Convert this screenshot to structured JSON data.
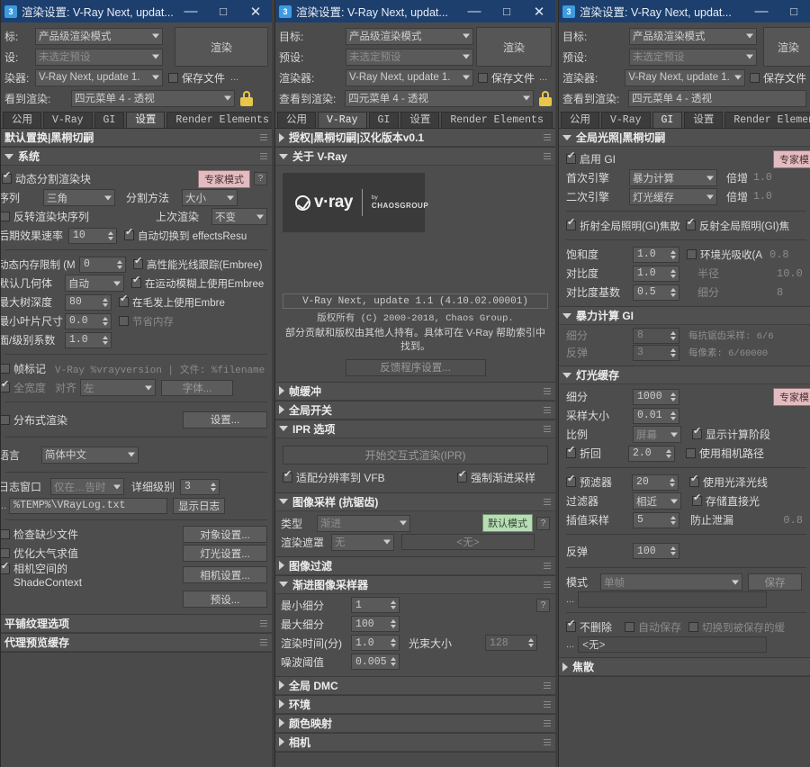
{
  "window": {
    "title": "渲染设置: V-Ray Next, updat...",
    "minimize": "—",
    "maximize": "□",
    "close": "✕",
    "icon_char": "3"
  },
  "topform": {
    "target_label": "目标:",
    "target_label_clipped": "标:",
    "target_value": "产品级渲染模式",
    "preset_label": "预设:",
    "preset_label_clipped": "设:",
    "preset_value": "未选定预设",
    "renderer_label": "渲染器:",
    "renderer_label_clipped": "染器:",
    "renderer_value": "V-Ray Next, update 1.",
    "view_label": "查看到渲染:",
    "view_label_clipped": "看到渲染:",
    "view_value": "四元菜单 4 - 透视",
    "render_button": "渲染",
    "save_file_label": "保存文件",
    "ellipsis": "..."
  },
  "tabs": {
    "items": [
      "公用",
      "V-Ray",
      "GI",
      "设置",
      "Render Elements"
    ],
    "active_win1": "设置",
    "active_win2": "V-Ray",
    "active_win3": "GI"
  },
  "win1": {
    "rollout_default": "默认置换|黑桐切嗣",
    "system": {
      "title": "系统",
      "expert_badge": "专家模式",
      "help": "?",
      "dynamic_split_label": "动态分割渲染块",
      "sequence_label": "序列",
      "sequence_value": "三角",
      "split_method_label": "分割方法",
      "split_method_value": "大小",
      "reverse_label": "反转渲染块序列",
      "last_render_label": "上次渲染",
      "last_render_value": "不变",
      "effects_rate_label": "后期效果速率",
      "effects_rate_value": "10",
      "auto_switch_label": "自动切换到 effectsResu",
      "dyn_mem_label": "动态内存限制 (M",
      "dyn_mem_value": "0",
      "embree_label": "高性能光线跟踪(Embree)",
      "default_geom_label": "默认几何体",
      "default_geom_value": "自动",
      "embree_motion_label": "在运动模糊上使用Embree",
      "max_tree_label": "最大树深度",
      "max_tree_value": "80",
      "embree_hair_label": "在毛发上使用Embre",
      "min_leaf_label": "最小叶片尺寸",
      "min_leaf_value": "0.0",
      "save_mem_label": "节省内存",
      "face_level_label": "面/级别系数",
      "face_level_value": "1.0"
    },
    "framestamp": {
      "label": "帧标记",
      "value": "V-Ray %vrayversion | 文件: %filename",
      "fullwidth_label": "全宽度",
      "align_label": "对齐",
      "align_value": "左",
      "font_button": "字体..."
    },
    "distributed": {
      "label": "分布式渲染",
      "settings_button": "设置..."
    },
    "language": {
      "label": "语言",
      "value": "简体中文"
    },
    "log": {
      "window_label": "日志窗口",
      "window_value": "仅在…告时",
      "verbosity_label": "详细级别",
      "verbosity_value": "3",
      "path_value": "%TEMP%\\VRayLog.txt",
      "show_log_button": "显示日志",
      "browse": "..."
    },
    "misc": {
      "check_missing_label": "检查缺少文件",
      "object_settings_button": "对象设置...",
      "optimize_atmo_label": "优化大气求值",
      "light_settings_button": "灯光设置...",
      "camera_space_label": "相机空间的 ShadeContext",
      "camera_settings_button": "相机设置...",
      "presets_button": "预设..."
    },
    "tiled_texture": "平铺纹理选项",
    "proxy_preview": "代理预览缓存"
  },
  "win2": {
    "authorization": "授权|黑桐切嗣|汉化版本v0.1",
    "about": {
      "title": "关于 V-Ray",
      "logo_word": "v·ray",
      "logo_by": "by",
      "logo_brand": "CHAOSGROUP",
      "version": "V-Ray Next, update 1.1 (4.10.02.00001)",
      "copyright": "版权所有 (C) 2000-2018, Chaos Group.",
      "notice": "部分贡献和版权由其他人持有。具体可在 V-Ray 帮助索引中找到。",
      "feedback_button": "反馈程序设置..."
    },
    "framebuffer": "帧缓冲",
    "global_switches": "全局开关",
    "ipr": {
      "title": "IPR 选项",
      "start_button": "开始交互式渲染(IPR)",
      "fit_res_label": "适配分辨率到 VFB",
      "force_progressive_label": "强制渐进采样"
    },
    "image_sampler": {
      "title": "图像采样 (抗锯齿)",
      "type_label": "类型",
      "type_value": "渐进",
      "default_badge": "默认模式",
      "help": "?",
      "mask_label": "渲染遮罩",
      "mask_value": "无",
      "mask_field": "<无>"
    },
    "image_filter": "图像过滤",
    "progressive_sampler": {
      "title": "渐进图像采样器",
      "min_subdiv_label": "最小细分",
      "min_subdiv_value": "1",
      "max_subdiv_label": "最大细分",
      "max_subdiv_value": "100",
      "render_time_label": "渲染时间(分)",
      "render_time_value": "1.0",
      "bundle_size_label": "光束大小",
      "bundle_size_value": "128",
      "noise_threshold_label": "噪波阈值",
      "noise_threshold_value": "0.005",
      "help": "?"
    },
    "global_dmc": "全局 DMC",
    "environment": "环境",
    "color_mapping": "颜色映射",
    "camera": "相机"
  },
  "win3": {
    "gi": {
      "title": "全局光照|黑桐切嗣",
      "enable_label": "启用 GI",
      "expert_badge": "专家模",
      "primary_label": "首次引擎",
      "primary_value": "暴力计算",
      "primary_mult_label": "倍增",
      "primary_mult_value": "1.0",
      "secondary_label": "二次引擎",
      "secondary_value": "灯光缓存",
      "secondary_mult_label": "倍增",
      "secondary_mult_value": "1.0",
      "refract_gi_label": "折射全局照明(GI)焦散",
      "reflect_gi_label": "反射全局照明(GI)焦",
      "saturation_label": "饱和度",
      "saturation_value": "1.0",
      "ao_label": "环境光吸收(A",
      "ao_value": "0.8",
      "contrast_label": "对比度",
      "contrast_value": "1.0",
      "radius_label": "半径",
      "radius_value": "10.0",
      "contrast_base_label": "对比度基数",
      "contrast_base_value": "0.5",
      "subdivs_label": "细分",
      "subdivs_value": "8"
    },
    "brute_force": {
      "title": "暴力计算 GI",
      "subdiv_label": "细分",
      "subdiv_value": "8",
      "bounce_label": "反弹",
      "bounce_value": "3",
      "note1": "每抗锯齿采样: 6/6",
      "note2": "每像素: 6/60000"
    },
    "light_cache": {
      "title": "灯光缓存",
      "expert_badge": "专家模",
      "subdivs_label": "细分",
      "subdivs_value": "1000",
      "sample_size_label": "采样大小",
      "sample_size_value": "0.01",
      "scale_label": "比例",
      "scale_value": "屏幕",
      "show_calc_label": "显示计算阶段",
      "retrace_label": "折回",
      "retrace_value": "2.0",
      "use_camera_path_label": "使用相机路径",
      "prefilter_label": "预滤器",
      "prefilter_value": "20",
      "use_glossy_label": "使用光泽光线",
      "filter_label": "过滤器",
      "filter_value": "相近",
      "store_direct_label": "存储直接光",
      "interp_label": "插值采样",
      "interp_value": "5",
      "leak_label": "防止泄漏",
      "leak_value": "0.8",
      "bounce_label": "反弹",
      "bounce_value": "100",
      "mode_label": "模式",
      "mode_value": "单帧",
      "save_button": "保存",
      "browse": "...",
      "dont_delete_label": "不删除",
      "auto_save_label": "自动保存",
      "switch_saved_label": "切换到被保存的缓",
      "file_value": "<无>"
    },
    "caustics": "焦散"
  }
}
